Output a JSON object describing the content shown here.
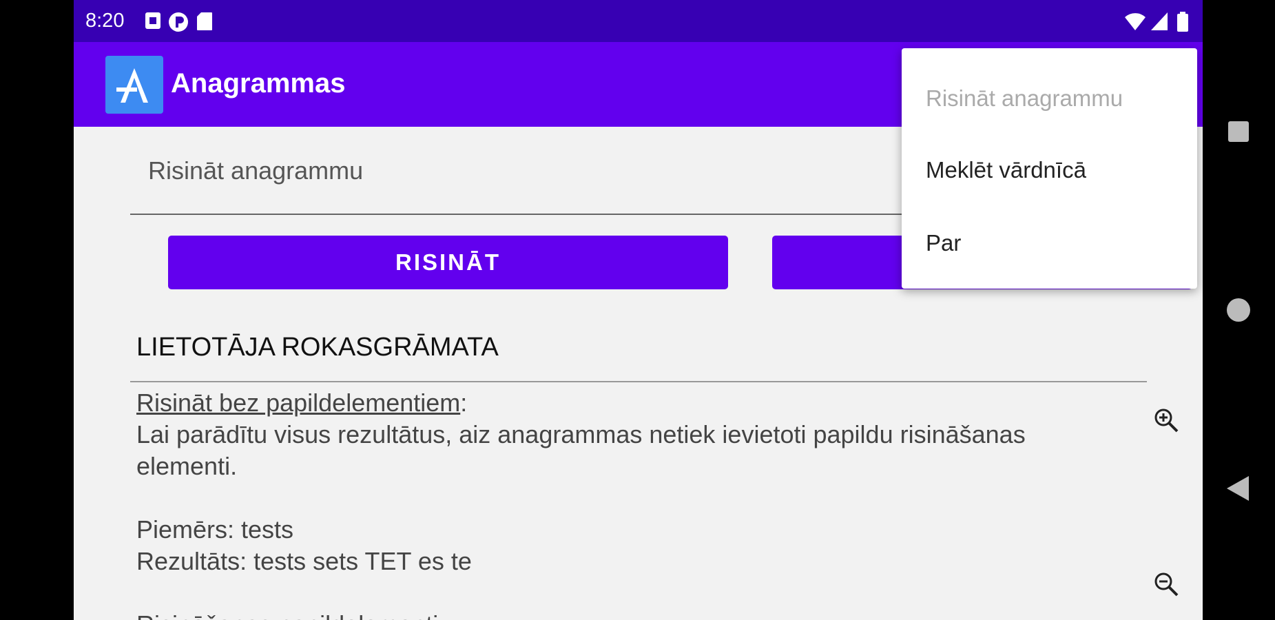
{
  "status_bar": {
    "time": "8:20"
  },
  "app_bar": {
    "title": "Anagrammas"
  },
  "input": {
    "value": "Risināt anagrammu"
  },
  "buttons": {
    "solve_label": "RISINĀT"
  },
  "manual": {
    "heading": "LIETOTĀJA ROKASGRĀMATA",
    "subheading": "Risināt bez papildelementiem",
    "subheading_suffix": ":",
    "description": "Lai parādītu visus rezultātus, aiz anagrammas netiek ievietoti papildu risināšanas elementi.",
    "example_line": "Piemērs: tests",
    "result_line": "Rezultāts: tests sets TET es te",
    "next_heading": "Risināšanas papildelementi:"
  },
  "menu": {
    "items": [
      {
        "label": "Risināt anagrammu",
        "enabled": false
      },
      {
        "label": "Meklēt vārdnīcā",
        "enabled": true
      },
      {
        "label": "Par",
        "enabled": true
      }
    ]
  },
  "colors": {
    "status_bar": "#3700b3",
    "app_bar": "#6200ee",
    "button": "#6200ee",
    "background": "#f2f2f2"
  }
}
